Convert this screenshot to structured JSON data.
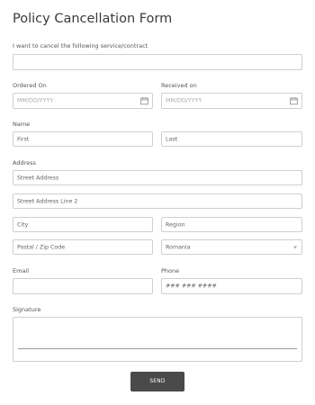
{
  "form": {
    "title": "Policy Cancellation Form",
    "service_label": "I want to cancel the following service/contract",
    "service_value": "",
    "ordered_on": {
      "label": "Ordered On",
      "placeholder": "MM/DD/YYYY",
      "icon": "calendar-icon"
    },
    "received_on": {
      "label": "Received on",
      "placeholder": "MM/DD/YYYY",
      "icon": "calendar-icon"
    },
    "name": {
      "label": "Name",
      "first_placeholder": "First",
      "last_placeholder": "Last"
    },
    "address": {
      "label": "Address",
      "street1_placeholder": "Street Address",
      "street2_placeholder": "Street Address Line 2",
      "city_placeholder": "City",
      "region_placeholder": "Region",
      "postal_placeholder": "Postal / Zip Code",
      "country_selected": "Romania"
    },
    "email": {
      "label": "Email",
      "value": ""
    },
    "phone": {
      "label": "Phone",
      "placeholder": "### ### ####"
    },
    "signature": {
      "label": "Signature"
    },
    "send_label": "SEND"
  }
}
